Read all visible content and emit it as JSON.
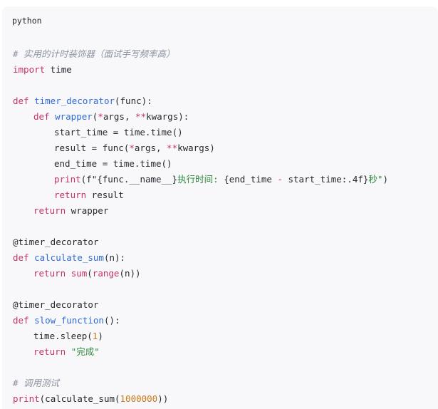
{
  "code_block": {
    "language_label": "python",
    "comment_header": "# 实用的计时装饰器（面试手写频率高）",
    "import_kw": "import",
    "import_mod": " time",
    "def_kw": "def",
    "decorator_name": "timer_decorator",
    "decorator_params": "(func):",
    "wrapper_name": "wrapper",
    "wrapper_params_open": "(",
    "star_args": "*",
    "args_text": "args, ",
    "dstar": "**",
    "kwargs_close": "kwargs):",
    "start_time_line": "start_time = time.time()",
    "result_line_a": "result = func(",
    "result_star": "*",
    "result_args": "args, ",
    "result_dstar": "**",
    "result_kwargs": "kwargs)",
    "end_time_line": "end_time = time.time()",
    "print_kw": "print",
    "print_open": "(",
    "fstring_a": "f\"",
    "fstring_b": "{func.__name__}",
    "fstring_c": "执行时间: ",
    "fstring_d": "{end_time ",
    "fstring_minus": "-",
    "fstring_e": " start_time:.4f}",
    "fstring_f": "秒\"",
    "print_close": ")",
    "return_kw": "return",
    "return_result": " result",
    "return_wrapper": " wrapper",
    "at_decorator": "@timer_decorator",
    "calc_name": "calculate_sum",
    "calc_params": "(n):",
    "sum_fn": "sum",
    "range_fn": "range",
    "sum_args_open": "(",
    "range_args": "(n))",
    "slow_name": "slow_function",
    "slow_params": "():",
    "sleep_a": "time.sleep(",
    "sleep_num": "1",
    "sleep_close": ")",
    "done_str": "\"完成\"",
    "comment_call": "# 调用测试",
    "call_open": "(calculate_sum(",
    "call_num": "1000000",
    "call_close": "))"
  },
  "colors": {
    "background": "#f8f8fb",
    "keyword": "#c4326b",
    "function_name": "#2f6bd6",
    "string": "#2d8a3a",
    "number": "#c87a19",
    "comment": "#8c93a0",
    "text": "#24292f"
  }
}
